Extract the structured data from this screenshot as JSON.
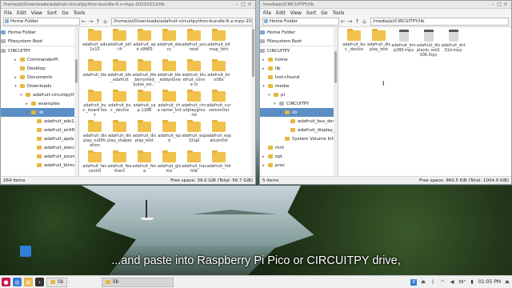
{
  "caption": "...and paste into Raspberry Pi Pico or CIRCUITPY drive,",
  "window_left": {
    "title": "/home/pi/Downloads/adafruit-circuitpython-bundle-6.x-mpy-20210212/lib",
    "menu": [
      "File",
      "Edit",
      "View",
      "Sort",
      "Go",
      "Tools"
    ],
    "side_selector": "Home Folder",
    "path": "/home/pi/Downloads/adafruit-circuitpython-bundle-6.x-mpy-20210212/lib",
    "places": [
      "Home Folder",
      "Filesystem Root",
      "CIRCUITPY"
    ],
    "tree": [
      {
        "label": "CommanderPi",
        "indent": 2,
        "exp": "▸",
        "type": "folder"
      },
      {
        "label": "Desktop",
        "indent": 2,
        "exp": "",
        "type": "folder"
      },
      {
        "label": "Documents",
        "indent": 2,
        "exp": "▸",
        "type": "folder"
      },
      {
        "label": "Downloads",
        "indent": 2,
        "exp": "▾",
        "type": "folder"
      },
      {
        "label": "adafruit-circuitpython-bundle",
        "indent": 3,
        "exp": "▾",
        "type": "folder"
      },
      {
        "label": "examples",
        "indent": 4,
        "exp": "▸",
        "type": "folder"
      },
      {
        "label": "lib",
        "indent": 4,
        "exp": "▾",
        "type": "folder",
        "selected": true
      },
      {
        "label": "adafruit_ads1x15",
        "indent": 5,
        "exp": "",
        "type": "folder"
      },
      {
        "label": "adafruit_airlift",
        "indent": 5,
        "exp": "",
        "type": "folder"
      },
      {
        "label": "adafruit_apds9960",
        "indent": 5,
        "exp": "",
        "type": "folder"
      },
      {
        "label": "adafruit_atecc",
        "indent": 5,
        "exp": "",
        "type": "folder"
      },
      {
        "label": "adafruit_azureiot",
        "indent": 5,
        "exp": "",
        "type": "folder"
      },
      {
        "label": "adafruit_bitmap_font",
        "indent": 5,
        "exp": "",
        "type": "folder"
      }
    ],
    "files": [
      "adafruit_ads 1x15",
      "adafruit_airli ft",
      "adafruit_apd s9960",
      "adafruit_ate cc",
      "adafruit_azu reiot",
      "adafruit_bit map_font",
      "adafruit_ble",
      "adafruit_ble _adafruit",
      "adafruit_ble _berrymed_ pulse_oxi...",
      "adafruit_ble _eddystone",
      "adafruit_blu efruit_conne ct",
      "adafruit_bn o08x",
      "adafruit_bus _board test",
      "adafruit_bus _device",
      "adafruit_cap 1188",
      "adafruit_cha racter_lcd",
      "adafruit_circ uitplaygrou nd",
      "adafruit_cur sorcontrol",
      "adafruit_dis play_notific ation",
      "adafruit_dis play_shapes",
      "adafruit_dis play_text",
      "adafruit_epd",
      "adafruit_esp 32spi",
      "adafruit_esp atcontrol",
      "adafruit_fan contol",
      "adafruit_fea thers",
      "adafruit_fon a",
      "adafruit_giz mo",
      "adafruit_has hlib",
      "adafruit_hid"
    ],
    "status_left": "264 items",
    "status_right": "Free space: 39.0 GiB (Total: 56.7 GiB)"
  },
  "window_right": {
    "title": "/media/pi/CIRCUITPY/lib",
    "menu": [
      "File",
      "Edit",
      "View",
      "Sort",
      "Go",
      "Tools"
    ],
    "side_selector": "Home Folder",
    "path": "/media/pi/CIRCUITPY/lib",
    "places": [
      "Home Folder",
      "Filesystem Root",
      "CIRCUITPY"
    ],
    "tree": [
      {
        "label": "home",
        "indent": 0,
        "exp": "▸",
        "type": "folder"
      },
      {
        "label": "lib",
        "indent": 0,
        "exp": "▸",
        "type": "folder"
      },
      {
        "label": "lost+found",
        "indent": 0,
        "exp": "",
        "type": "folder"
      },
      {
        "label": "media",
        "indent": 0,
        "exp": "▾",
        "type": "folder"
      },
      {
        "label": "pi",
        "indent": 1,
        "exp": "▾",
        "type": "folder"
      },
      {
        "label": "CIRCUITPY",
        "indent": 2,
        "exp": "▾",
        "type": "drive"
      },
      {
        "label": "lib",
        "indent": 3,
        "exp": "▾",
        "type": "folder",
        "selected": true
      },
      {
        "label": "adafruit_bus_device",
        "indent": 4,
        "exp": "",
        "type": "folder"
      },
      {
        "label": "adafruit_display_text",
        "indent": 4,
        "exp": "",
        "type": "folder"
      },
      {
        "label": "System Volume Information",
        "indent": 3,
        "exp": "",
        "type": "folder"
      },
      {
        "label": "mnt",
        "indent": 0,
        "exp": "",
        "type": "folder"
      },
      {
        "label": "opt",
        "indent": 0,
        "exp": "▸",
        "type": "folder"
      },
      {
        "label": "proc",
        "indent": 0,
        "exp": "▸",
        "type": "folder"
      }
    ],
    "files": [
      {
        "label": "adafruit_bus _device",
        "kind": "folder"
      },
      {
        "label": "adafruit_dis play_text",
        "kind": "folder"
      },
      {
        "label": "adafruit_bm p280.mpy",
        "kind": "file"
      },
      {
        "label": "adafruit_dis playio_ssd1 306.mpy",
        "kind": "file"
      },
      {
        "label": "adafruit_sht 31d.mpy",
        "kind": "file"
      }
    ],
    "status_left": "5 items",
    "status_right": "Free space: 960.5 KiB (Total: 1004.0 KiB)"
  },
  "taskbar": {
    "tasks": [
      {
        "label": "lib",
        "active": false
      },
      {
        "label": "lib",
        "active": true
      }
    ],
    "volume": "39°",
    "clock": "01:05 PM"
  }
}
